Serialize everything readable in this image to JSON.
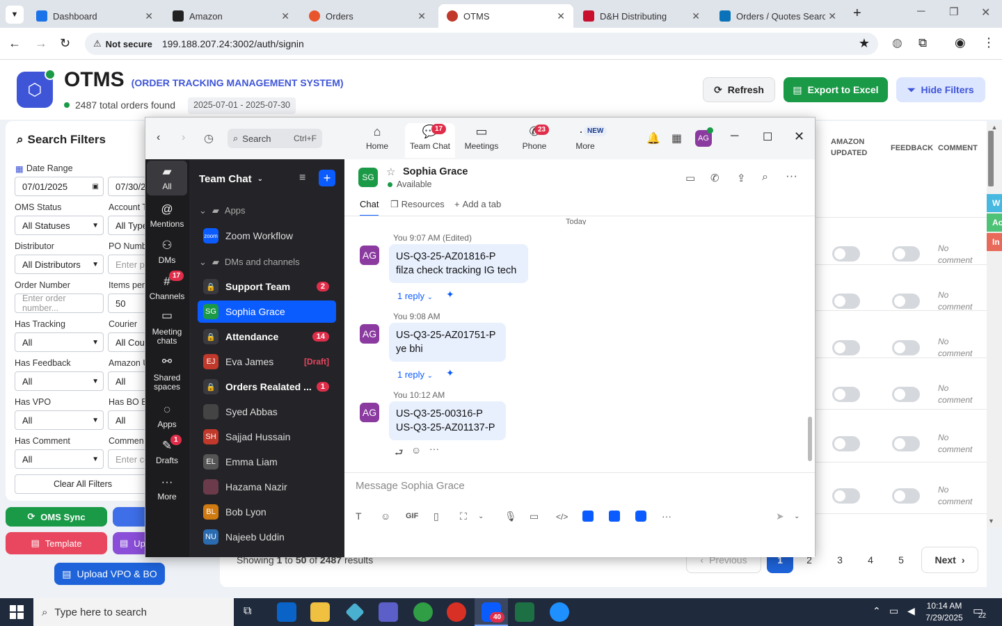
{
  "browser": {
    "tabs": [
      {
        "label": "Dashboard",
        "color": "#1a73e8"
      },
      {
        "label": "Amazon",
        "color": "#222222"
      },
      {
        "label": "Orders",
        "color": "#e8542b"
      },
      {
        "label": "OTMS",
        "color": "#c0392b"
      },
      {
        "label": "D&H Distributing",
        "color": "#c8102e"
      },
      {
        "label": "Orders / Quotes Search",
        "color": "#0a72b8"
      }
    ],
    "not_secure": "Not secure",
    "url": "199.188.207.24:3002/auth/signin"
  },
  "app": {
    "title": "OTMS",
    "subtitle": "(ORDER TRACKING MANAGEMENT SYSTEM)",
    "orders_found": "2487 total orders found",
    "date_range_badge": "2025-07-01 - 2025-07-30",
    "refresh_label": "Refresh",
    "export_label": "Export to Excel",
    "hide_filters_label": "Hide Filters",
    "accent": "#3e55d8",
    "green": "#1a9a47"
  },
  "filters": {
    "title": "Search Filters",
    "date_range_label": "Date Range",
    "date_from": "07/01/2025",
    "date_to": "07/30/2",
    "oms_status_label": "OMS Status",
    "oms_status_value": "All Statuses",
    "account_label": "Account T",
    "account_value": "All Type",
    "distributor_label": "Distributor",
    "distributor_value": "All Distributors",
    "po_label": "PO Numb",
    "po_placeholder": "Enter po",
    "order_number_label": "Order Number",
    "order_number_placeholder": "Enter order number...",
    "items_label": "Items per",
    "items_value": "50",
    "tracking_label": "Has Tracking",
    "tracking_value": "All",
    "courier_label": "Courier",
    "courier_value": "All Cou",
    "feedback_label": "Has Feedback",
    "feedback_value": "All",
    "amazon_label": "Amazon U",
    "amazon_value": "All",
    "vpo_label": "Has VPO",
    "vpo_value": "All",
    "bo_label": "Has BO E",
    "bo_value": "All",
    "comment_label": "Has Comment",
    "comment_value": "All",
    "comment2_label": "Commen",
    "comment2_placeholder": "Enter co",
    "clear_label": "Clear All Filters",
    "oms_sync_label": "OMS Sync",
    "template_label": "Template",
    "upload_partial_label": "Up",
    "upload_vpo_label": "Upload VPO & BO"
  },
  "table": {
    "col_amazon": "AMAZON UPDATED",
    "col_feedback": "FEEDBACK",
    "col_comment": "COMMENT",
    "no_comment": "No comment",
    "side_tags": [
      "W",
      "Ac",
      "In"
    ],
    "showing_prefix": "Showing",
    "showing_from": "1",
    "showing_to_word": "to",
    "showing_to": "50",
    "showing_of_word": "of",
    "showing_total": "2487",
    "showing_suffix": "results",
    "previous": "Previous",
    "next": "Next",
    "pages": [
      "1",
      "2",
      "3",
      "4",
      "5"
    ]
  },
  "zoom": {
    "search_label": "Search",
    "search_shortcut": "Ctrl+F",
    "nav": [
      {
        "label": "Home"
      },
      {
        "label": "Team Chat",
        "badge": "17"
      },
      {
        "label": "Meetings"
      },
      {
        "label": "Phone",
        "badge": "23"
      },
      {
        "label": "More",
        "badge": "NEW"
      }
    ],
    "user_initials": "AG",
    "rail": [
      {
        "label": "All"
      },
      {
        "label": "Mentions"
      },
      {
        "label": "DMs"
      },
      {
        "label": "Channels",
        "badge": "17"
      },
      {
        "label": "Meeting chats"
      },
      {
        "label": "Shared spaces"
      },
      {
        "label": "Apps"
      },
      {
        "label": "Drafts",
        "badge": "1"
      },
      {
        "label": "More"
      }
    ],
    "list_title": "Team Chat",
    "section_apps": "Apps",
    "zoom_workflow": "Zoom Workflow",
    "section_dms": "DMs and channels",
    "chats": [
      {
        "name": "Support Team",
        "bold": true,
        "badge": "2",
        "initials": "",
        "color": "#3a3a3e"
      },
      {
        "name": "Sophia Grace",
        "selected": true,
        "initials": "SG",
        "color": "#1a9a47"
      },
      {
        "name": "Attendance",
        "bold": true,
        "badge": "14",
        "initials": "",
        "color": "#3a3a3e"
      },
      {
        "name": "Eva James",
        "draft": "[Draft]",
        "initials": "EJ",
        "color": "#c0392b"
      },
      {
        "name": "Orders Realated ...",
        "bold": true,
        "badge": "1",
        "initials": "",
        "color": "#3a3a3e"
      },
      {
        "name": "Syed Abbas",
        "initials": "",
        "color": "#444"
      },
      {
        "name": "Sajjad Hussain",
        "initials": "SH",
        "color": "#c0392b"
      },
      {
        "name": "Emma Liam",
        "initials": "EL",
        "color": "#555"
      },
      {
        "name": "Hazama Nazir",
        "initials": "",
        "color": "#6b3b4b"
      },
      {
        "name": "Bob Lyon",
        "initials": "BL",
        "color": "#d07a12"
      },
      {
        "name": "Najeeb Uddin",
        "initials": "NU",
        "color": "#2b6cb0"
      }
    ],
    "contact_name": "Sophia Grace",
    "contact_initials": "SG",
    "contact_status": "Available",
    "tab_chat": "Chat",
    "tab_resources": "Resources",
    "tab_add": "Add a tab",
    "today": "Today",
    "messages": [
      {
        "meta": "You 9:07 AM (Edited)",
        "lines": [
          "US-Q3-25-AZ01816-P",
          "filza check tracking IG tech"
        ],
        "reply": "1 reply"
      },
      {
        "meta": "You 9:08 AM",
        "lines": [
          "US-Q3-25-AZ01751-P",
          "ye bhi"
        ],
        "reply": "1 reply"
      },
      {
        "meta": "You 10:12 AM",
        "lines": [
          "US-Q3-25-00316-P",
          "US-Q3-25-AZ01137-P"
        ]
      }
    ],
    "composer_placeholder": "Message Sophia Grace",
    "gif_label": "GIF"
  },
  "taskbar": {
    "search_placeholder": "Type here to search",
    "time": "10:14 AM",
    "date": "7/29/2025",
    "notif_count": "22",
    "zoom_badge": "40"
  }
}
